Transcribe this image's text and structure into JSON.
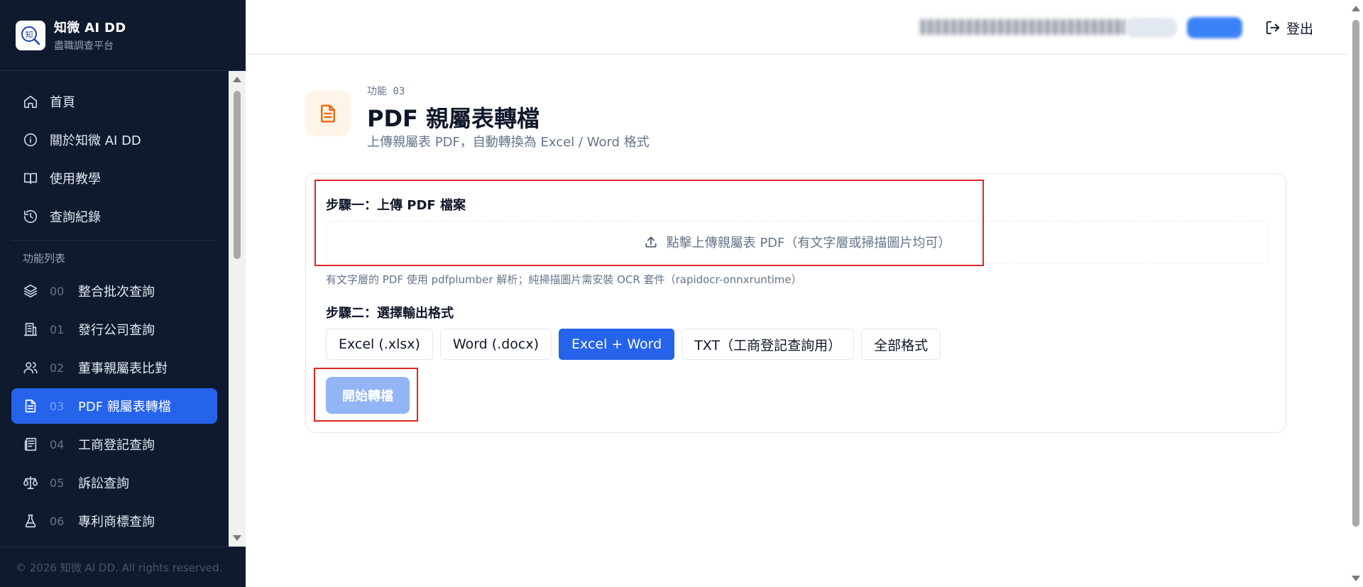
{
  "brand": {
    "title": "知微 AI DD",
    "subtitle": "盡職調查平台",
    "logo_char": "知"
  },
  "sidebar": {
    "items": [
      {
        "label": "首頁",
        "icon": "home-icon"
      },
      {
        "label": "關於知微 AI DD",
        "icon": "info-icon"
      },
      {
        "label": "使用教學",
        "icon": "book-icon"
      },
      {
        "label": "查詢紀錄",
        "icon": "history-icon"
      }
    ],
    "section_title": "功能列表",
    "features": [
      {
        "num": "00",
        "label": "整合批次查詢",
        "icon": "layers-icon"
      },
      {
        "num": "01",
        "label": "發行公司查詢",
        "icon": "building-icon"
      },
      {
        "num": "02",
        "label": "董事親屬表比對",
        "icon": "users-icon"
      },
      {
        "num": "03",
        "label": "PDF 親屬表轉檔",
        "icon": "document-icon",
        "active": true
      },
      {
        "num": "04",
        "label": "工商登記查詢",
        "icon": "newspaper-icon"
      },
      {
        "num": "05",
        "label": "訴訟查詢",
        "icon": "scale-icon"
      },
      {
        "num": "06",
        "label": "專利商標查詢",
        "icon": "flask-icon"
      }
    ],
    "footer": "© 2026 知微 AI DD. All rights reserved."
  },
  "header": {
    "logout_label": "登出"
  },
  "page": {
    "meta": "功能 03",
    "title": "PDF 親屬表轉檔",
    "subtitle": "上傳親屬表 PDF，自動轉換為 Excel / Word 格式"
  },
  "form": {
    "step1_label": "步驟一：上傳 PDF 檔案",
    "upload_text": "點擊上傳親屬表 PDF（有文字層或掃描圖片均可）",
    "hint": "有文字層的 PDF 使用 pdfplumber 解析；純掃描圖片需安裝 OCR 套件（rapidocr-onnxruntime）",
    "step2_label": "步驟二：選擇輸出格式",
    "formats": [
      "Excel (.xlsx)",
      "Word (.docx)",
      "Excel + Word",
      "TXT（工商登記查詢用）",
      "全部格式"
    ],
    "selected_format": "Excel + Word",
    "start_label": "開始轉檔"
  },
  "colors": {
    "sidebar_bg": "#0f1a2e",
    "accent": "#2563eb",
    "highlight": "#dc2626",
    "icon_orange": "#ea6a14"
  }
}
